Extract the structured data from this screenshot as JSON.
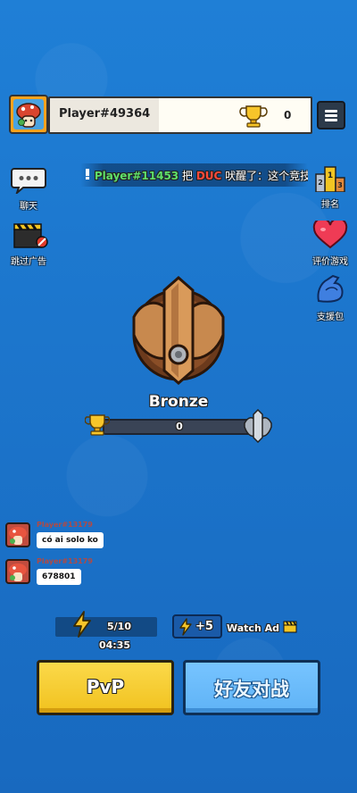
{
  "player": {
    "name": "Player#49364",
    "trophies": "0"
  },
  "ticker": {
    "player": "Player#11453",
    "verb": "把",
    "target": "DUC",
    "message": "吠醒了：这个竞技场"
  },
  "side_left": [
    {
      "label": "聊天",
      "icon": "chat-bubble-icon"
    },
    {
      "label": "跳过广告",
      "icon": "clapperboard-icon"
    }
  ],
  "side_right": [
    {
      "label": "排名",
      "icon": "podium-icon"
    },
    {
      "label": "评价游戏",
      "icon": "heart-icon"
    },
    {
      "label": "支援包",
      "icon": "bicep-icon"
    }
  ],
  "rank": {
    "name": "Bronze",
    "progress_value": "0",
    "progress_fraction": 0
  },
  "chat": [
    {
      "user": "Player#13179",
      "message": "có ai solo ko"
    },
    {
      "user": "Player#13179",
      "message": "678801"
    }
  ],
  "energy": {
    "value": "5/10",
    "timer": "04:35"
  },
  "watch_ad": {
    "bonus": "+5",
    "label": "Watch Ad"
  },
  "buttons": {
    "pvp": "PvP",
    "friend": "好友对战"
  },
  "colors": {
    "background": "#1a73c9",
    "pvp": "#f1c21f",
    "friend": "#5fb3f6",
    "accent_gold": "#f3c542"
  }
}
